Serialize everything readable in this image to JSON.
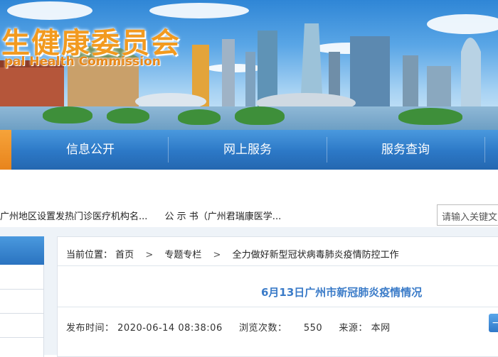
{
  "banner": {
    "title_cn": "生健康委员会",
    "title_en": "pal Health Commission"
  },
  "nav": {
    "items": [
      "信息公开",
      "网上服务",
      "服务查询"
    ]
  },
  "ticker": {
    "items": [
      "广州地区设置发热门诊医疗机构名...",
      "公  示  书（广州君瑞康医学..."
    ]
  },
  "search": {
    "placeholder": "请输入关键文"
  },
  "breadcrumb": {
    "label": "当前位置：",
    "items": [
      "首页",
      "专题专栏",
      "全力做好新型冠状病毒肺炎疫情防控工作"
    ],
    "separator": ">"
  },
  "article": {
    "title": "6月13日广州市新冠肺炎疫情情况",
    "published_label": "发布时间：",
    "published_value": "2020-06-14 08:38:06",
    "views_label": "浏览次数：",
    "views_value": "550",
    "source_label": "来源：",
    "source_value": "本网"
  },
  "colors": {
    "nav_blue": "#2c78c6",
    "accent_orange": "#f29a1f",
    "title_blue": "#3a7bc8"
  }
}
